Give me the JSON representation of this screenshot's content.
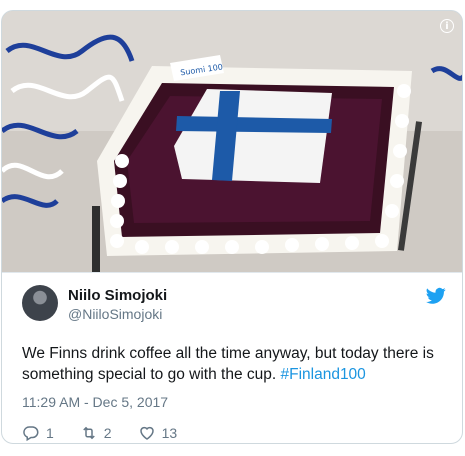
{
  "tweet": {
    "author_name": "Niilo Simojoki",
    "author_handle": "@NiiloSimojoki",
    "text_main": "We Finns drink coffee all the time anyway, but today there is something special to go with the cup. ",
    "hashtag": "#Finland100",
    "timestamp": "11:29 AM - Dec 5, 2017",
    "reply_count": "1",
    "retweet_count": "2",
    "like_count": "13"
  },
  "media": {
    "cake_text": "Suomi 100"
  },
  "colors": {
    "twitter_blue": "#1da1f2",
    "hashtag_blue": "#1b95e0",
    "finland_blue": "#1d5aa8"
  }
}
